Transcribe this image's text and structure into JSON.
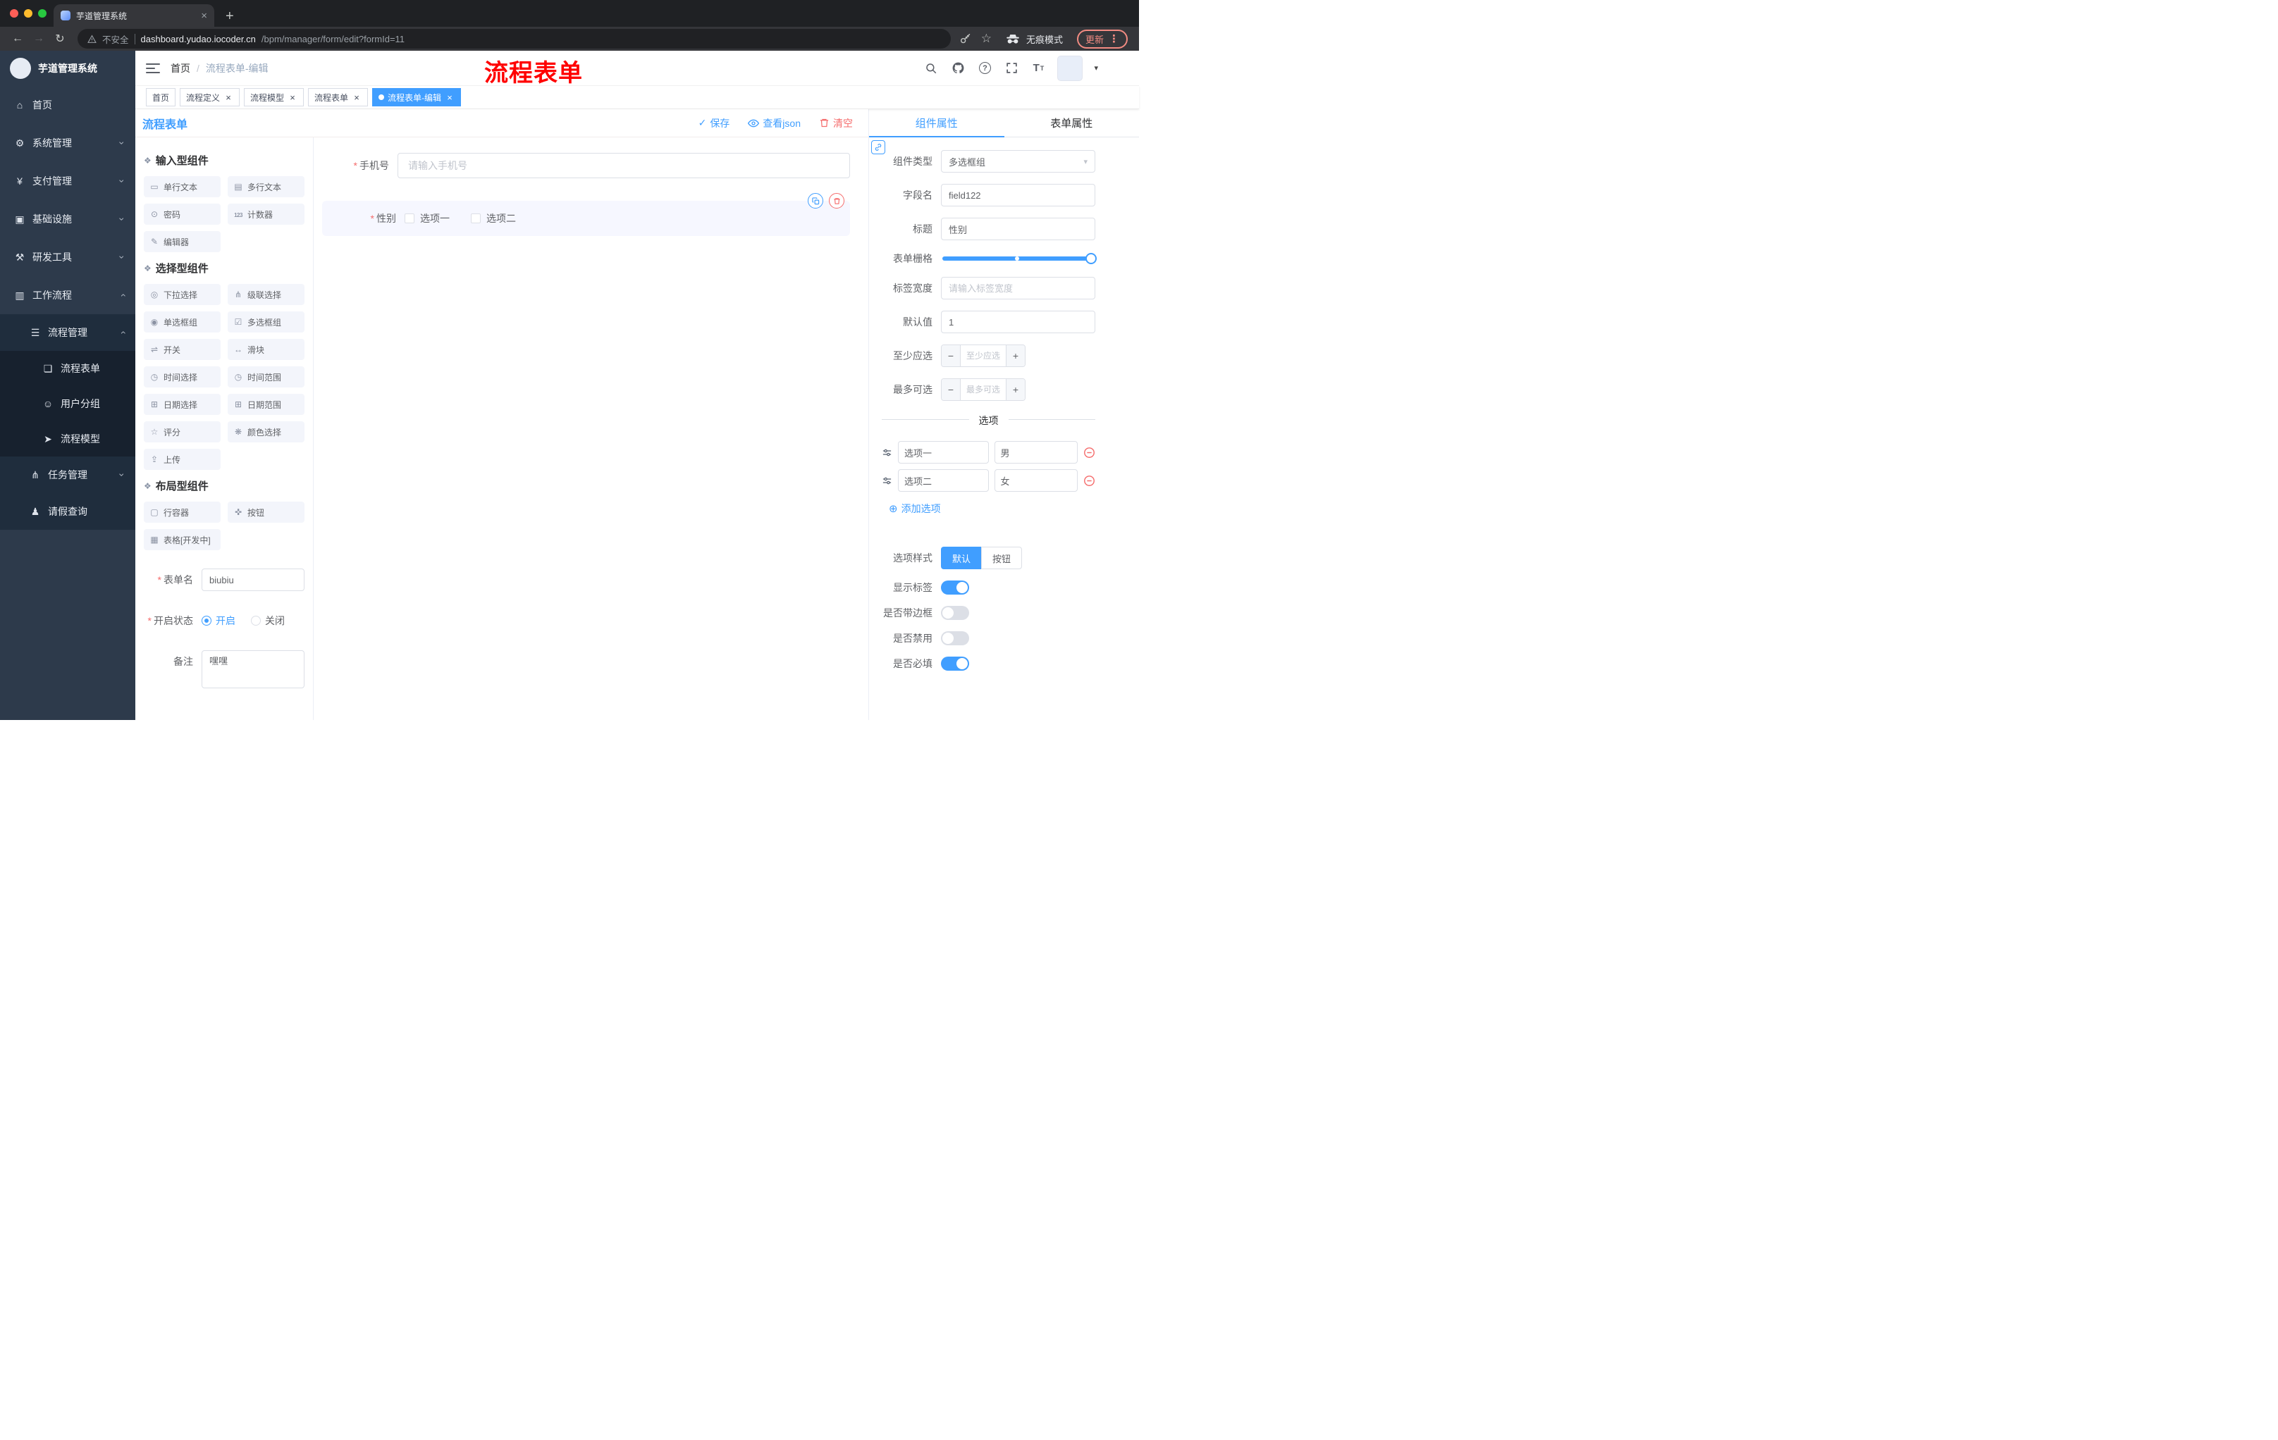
{
  "theme": {
    "accent": "#409eff",
    "danger": "#f56c6c",
    "sidebar_bg": "#2d3a4b",
    "annotation_color": "#ff0000",
    "tag_active_bg": "#409eff"
  },
  "browser": {
    "tab_title": "芋道管理系统",
    "security_label": "不安全",
    "url_domain": "dashboard.yudao.iocoder.cn",
    "url_path": "/bpm/manager/form/edit?formId=11",
    "incognito_label": "无痕模式",
    "update_label": "更新",
    "icons": [
      "back-icon",
      "forward-icon",
      "reload-icon",
      "warning-icon",
      "key-icon",
      "star-icon",
      "incognito-icon",
      "more-icon",
      "new-tab-icon",
      "tab-close-icon"
    ]
  },
  "sidebar": {
    "logo_title": "芋道管理系统",
    "menu": [
      {
        "label": "首页",
        "icon": "home-icon",
        "level": 1
      },
      {
        "label": "系统管理",
        "icon": "gear-icon",
        "level": 1,
        "expandable": true
      },
      {
        "label": "支付管理",
        "icon": "payment-icon",
        "level": 1,
        "expandable": true
      },
      {
        "label": "基础设施",
        "icon": "infrastructure-icon",
        "level": 1,
        "expandable": true
      },
      {
        "label": "研发工具",
        "icon": "devtools-icon",
        "level": 1,
        "expandable": true
      },
      {
        "label": "工作流程",
        "icon": "workflow-icon",
        "level": 1,
        "expandable": true,
        "expanded": true
      },
      {
        "label": "流程管理",
        "icon": "process-manage-icon",
        "level": 2,
        "expandable": true,
        "expanded": true
      },
      {
        "label": "流程表单",
        "icon": "process-form-icon",
        "level": 3,
        "active": true
      },
      {
        "label": "用户分组",
        "icon": "user-group-icon",
        "level": 3
      },
      {
        "label": "流程模型",
        "icon": "process-model-icon",
        "level": 3
      },
      {
        "label": "任务管理",
        "icon": "task-manage-icon",
        "level": 2,
        "expandable": true
      },
      {
        "label": "请假查询",
        "icon": "leave-query-icon",
        "level": 2
      }
    ]
  },
  "navbar": {
    "breadcrumb_root": "首页",
    "breadcrumb_separator": "/",
    "breadcrumb_current": "流程表单-编辑",
    "annotation": "流程表单",
    "icons": [
      "search-icon",
      "github-icon",
      "help-icon",
      "fullscreen-icon",
      "font-size-icon",
      "avatar",
      "chevron-down-icon"
    ]
  },
  "tags": {
    "items": [
      {
        "label": "首页",
        "closable": false,
        "active": false
      },
      {
        "label": "流程定义",
        "closable": true,
        "active": false
      },
      {
        "label": "流程模型",
        "closable": true,
        "active": false
      },
      {
        "label": "流程表单",
        "closable": true,
        "active": false
      },
      {
        "label": "流程表单-编辑",
        "closable": true,
        "active": true
      }
    ]
  },
  "toolbar": {
    "title": "流程表单",
    "save": "保存",
    "view_json": "查看json",
    "clear": "清空"
  },
  "palette": {
    "sections": [
      {
        "title": "输入型组件",
        "items": [
          {
            "label": "单行文本",
            "icon": "single-line-text-icon"
          },
          {
            "label": "多行文本",
            "icon": "multi-line-text-icon"
          },
          {
            "label": "密码",
            "icon": "password-icon"
          },
          {
            "label": "计数器",
            "icon": "counter-icon"
          },
          {
            "label": "编辑器",
            "icon": "editor-icon"
          }
        ]
      },
      {
        "title": "选择型组件",
        "items": [
          {
            "label": "下拉选择",
            "icon": "select-icon"
          },
          {
            "label": "级联选择",
            "icon": "cascader-icon"
          },
          {
            "label": "单选框组",
            "icon": "radio-group-icon"
          },
          {
            "label": "多选框组",
            "icon": "checkbox-group-icon"
          },
          {
            "label": "开关",
            "icon": "switch-icon"
          },
          {
            "label": "滑块",
            "icon": "slider-icon"
          },
          {
            "label": "时间选择",
            "icon": "time-picker-icon"
          },
          {
            "label": "时间范围",
            "icon": "time-range-icon"
          },
          {
            "label": "日期选择",
            "icon": "date-picker-icon"
          },
          {
            "label": "日期范围",
            "icon": "date-range-icon"
          },
          {
            "label": "评分",
            "icon": "rate-icon"
          },
          {
            "label": "颜色选择",
            "icon": "color-picker-icon"
          },
          {
            "label": "上传",
            "icon": "upload-icon"
          }
        ]
      },
      {
        "title": "布局型组件",
        "items": [
          {
            "label": "行容器",
            "icon": "row-container-icon"
          },
          {
            "label": "按钮",
            "icon": "button-icon"
          },
          {
            "label": "表格[开发中]",
            "icon": "table-icon"
          }
        ]
      }
    ],
    "meta": {
      "form_name_label": "表单名",
      "form_name_value": "biubiu",
      "status_label": "开启状态",
      "status_on": "开启",
      "status_off": "关闭",
      "status_selected": "开启",
      "remark_label": "备注",
      "remark_value": "嘿嘿"
    }
  },
  "canvas": {
    "phone": {
      "label": "手机号",
      "required": true,
      "placeholder": "请输入手机号"
    },
    "gender": {
      "label": "性别",
      "required": true,
      "options": [
        "选项一",
        "选项二"
      ],
      "selected": true
    }
  },
  "props": {
    "tab_component": "组件属性",
    "tab_form": "表单属性",
    "rows": {
      "type_label": "组件类型",
      "type_value": "多选框组",
      "field_label": "字段名",
      "field_value": "field122",
      "title_label": "标题",
      "title_value": "性别",
      "grid_label": "表单栅格",
      "width_label": "标签宽度",
      "width_placeholder": "请输入标签宽度",
      "default_label": "默认值",
      "default_value": "1",
      "min_label": "至少应选",
      "min_placeholder": "至少应选",
      "max_label": "最多可选",
      "max_placeholder": "最多可选"
    },
    "options": {
      "divider": "选项",
      "rows": [
        {
          "name": "选项一",
          "value": "男"
        },
        {
          "name": "选项二",
          "value": "女"
        }
      ],
      "add": "添加选项"
    },
    "style_label": "选项样式",
    "style_default": "默认",
    "style_button": "按钮",
    "style_selected": "默认",
    "switches": [
      {
        "label": "显示标签",
        "on": true
      },
      {
        "label": "是否带边框",
        "on": false
      },
      {
        "label": "是否禁用",
        "on": false
      },
      {
        "label": "是否必填",
        "on": true
      }
    ]
  }
}
